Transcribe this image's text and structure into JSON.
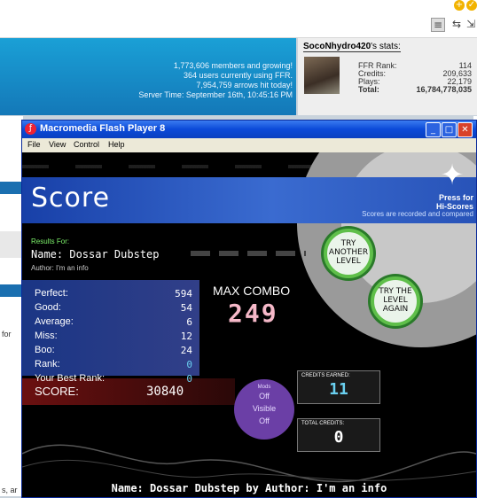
{
  "toolbar": {
    "icons": [
      "list-icon",
      "swap-icon",
      "collapse-icon"
    ],
    "corner_plus": "+",
    "corner_check": "✓"
  },
  "site": {
    "stats_lines": [
      "1,773,606 members and growing!",
      "364 users currently using FFR.",
      "7,954,759 arrows hit today!",
      "Server Time: September 16th, 10:45:16 PM"
    ],
    "user": {
      "name": "SocoNhydro420",
      "stats_suffix": "'s stats:",
      "rows": [
        {
          "label": "FFR Rank:",
          "value": "114"
        },
        {
          "label": "Credits:",
          "value": "209,633"
        },
        {
          "label": "Plays:",
          "value": "22,179"
        },
        {
          "label": "Total:",
          "value": "16,784,778,035"
        }
      ]
    },
    "edge_text_1": "for",
    "edge_text_2": "s, ar"
  },
  "window": {
    "title": "Macromedia Flash Player 8",
    "menu": [
      "File",
      "View",
      "Control",
      "Help"
    ],
    "controls": {
      "minimize": "_",
      "maximize": "□",
      "close": "✕"
    }
  },
  "game": {
    "score_title": "Score",
    "press_for": [
      "Press for",
      "Hi-Scores"
    ],
    "recorded_note": "Scores are recorded and compared",
    "results_for": "Results For:",
    "name_line": "Name: Dossar Dubstep",
    "author_line": "Author: I'm an info",
    "stats": [
      {
        "label": "Perfect:",
        "value": "594",
        "color": "#ffffff"
      },
      {
        "label": "Good:",
        "value": "54",
        "color": "#ffffff"
      },
      {
        "label": "Average:",
        "value": "6",
        "color": "#ffffff"
      },
      {
        "label": "Miss:",
        "value": "12",
        "color": "#ffffff"
      },
      {
        "label": "Boo:",
        "value": "24",
        "color": "#ffffff"
      },
      {
        "label": "Rank:",
        "value": "0",
        "color": "#6ad0f0"
      },
      {
        "label": "Your Best Rank:",
        "value": "0",
        "color": "#6ad0f0"
      }
    ],
    "max_combo_label": "MAX COMBO",
    "max_combo_value": "249",
    "score_label": "SCORE:",
    "score_value": "30840",
    "mods": {
      "title": "Mods",
      "line1": "Off",
      "line2": "Visible",
      "line3": "Off"
    },
    "credits_earned_label": "CREDITS EARNED:",
    "credits_earned_value": "11",
    "credits_earned_color": "#6ad0f0",
    "total_credits_label": "TOTAL CREDITS:",
    "total_credits_value": "0",
    "total_credits_color": "#ffffff",
    "buttons": {
      "try_another": [
        "TRY",
        "ANOTHER",
        "LEVEL"
      ],
      "try_again": [
        "TRY THE",
        "LEVEL",
        "AGAIN"
      ]
    },
    "footer": "Name: Dossar Dubstep by Author: I'm an info"
  }
}
